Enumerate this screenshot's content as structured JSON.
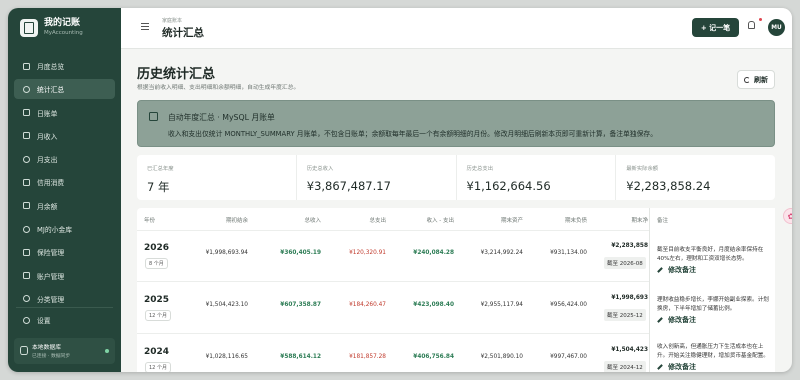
{
  "brand": {
    "title": "我的记账",
    "subtitle": "MyAccounting"
  },
  "sidebar": {
    "items": [
      {
        "label": "月度总览",
        "icon": "calendar-icon"
      },
      {
        "label": "统计汇总",
        "icon": "chart-icon"
      },
      {
        "label": "日账单",
        "icon": "plus-icon"
      },
      {
        "label": "月收入",
        "icon": "income-icon"
      },
      {
        "label": "月支出",
        "icon": "pie-icon"
      },
      {
        "label": "信用消费",
        "icon": "card-icon"
      },
      {
        "label": "月余额",
        "icon": "wallet-icon"
      },
      {
        "label": "MJ的小金库",
        "icon": "vault-icon"
      },
      {
        "label": "保险管理",
        "icon": "shield-icon"
      },
      {
        "label": "账户管理",
        "icon": "account-icon"
      },
      {
        "label": "分类管理",
        "icon": "tag-icon"
      }
    ],
    "active_index": 1,
    "settings": {
      "label": "设置",
      "icon": "gear-icon"
    },
    "db": {
      "title": "本地数据库",
      "subtitle": "已连接 · 数据同步"
    }
  },
  "topbar": {
    "crumb_small": "家庭账本",
    "crumb_title": "统计汇总",
    "add_label": "+ 记一笔",
    "avatar": "MU"
  },
  "page": {
    "title": "历史统计汇总",
    "subtitle": "根据当前收入明细、支出明细和余额明细，自动生成年度汇总。",
    "refresh_label": "刷新"
  },
  "banner": {
    "title": "自动年度汇总 · MySQL 月账单",
    "text": "收入和支出仅统计 MONTHLY_SUMMARY 月账单，不包含日账单；余额取每年最后一个有余额明细的月份。修改月明细后刷新本页即可重新计算，备注单独保存。"
  },
  "stats": [
    {
      "label": "已汇总年度",
      "value": "7 年"
    },
    {
      "label": "历史总收入",
      "value": "¥3,867,487.17"
    },
    {
      "label": "历史总支出",
      "value": "¥1,162,664.56"
    },
    {
      "label": "最新实际余额",
      "value": "¥2,283,858.24"
    }
  ],
  "table": {
    "headers": [
      "年份",
      "期初结余",
      "总收入",
      "总支出",
      "收入 - 支出",
      "期末资产",
      "期末负债",
      "期末净"
    ],
    "rows": [
      {
        "year": "2026",
        "months": "8 个月",
        "open": "¥1,998,693.94",
        "income": "¥360,405.19",
        "expense": "¥120,320.91",
        "net": "¥240,084.28",
        "asset": "¥3,214,992.24",
        "liab": "¥931,134.00",
        "close": "¥2,283,858",
        "until": "截至 2026-08"
      },
      {
        "year": "2025",
        "months": "12 个月",
        "open": "¥1,504,423.10",
        "income": "¥607,358.87",
        "expense": "¥184,260.47",
        "net": "¥423,098.40",
        "asset": "¥2,955,117.94",
        "liab": "¥956,424.00",
        "close": "¥1,998,693",
        "until": "截至 2025-12"
      },
      {
        "year": "2024",
        "months": "12 个月",
        "open": "¥1,028,116.65",
        "income": "¥588,614.12",
        "expense": "¥181,857.28",
        "net": "¥406,756.84",
        "asset": "¥2,501,890.10",
        "liab": "¥997,467.00",
        "close": "¥1,504,423",
        "until": "截至 2024-12"
      }
    ]
  },
  "notes": {
    "header": "备注",
    "edit_label": "修改备注",
    "items": [
      "截至目前收支平衡良好，月度结余率保持在40%左右，理财和工资双增长态势。",
      "理财收益稳步增长，李娜开始副业探索。计划换房，下半年增加了储蓄比例。",
      "收入创新高，但通胀压力下生活成本也在上升。开始关注稳健理财，增加货币基金配置。"
    ]
  },
  "colors": {
    "sidebar": "#25453a",
    "income": "#2e7d56",
    "expense": "#c0392b",
    "banner": "#8da197"
  }
}
